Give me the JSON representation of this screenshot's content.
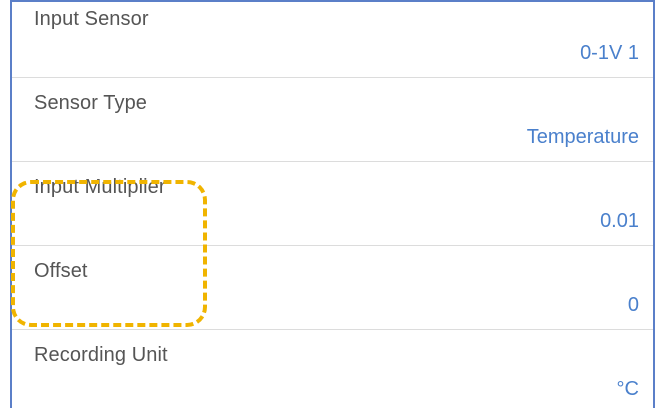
{
  "settings": [
    {
      "label": "Input Sensor",
      "value": "0-1V 1"
    },
    {
      "label": "Sensor Type",
      "value": "Temperature"
    },
    {
      "label": "Input Multiplier",
      "value": "0.01"
    },
    {
      "label": "Offset",
      "value": "0"
    },
    {
      "label": "Recording Unit",
      "value": "°C"
    }
  ],
  "colors": {
    "label": "#555555",
    "value": "#4a80cc",
    "frame": "#5b7fc8",
    "highlight": "#f0b400",
    "divider": "#dcdcdc"
  }
}
